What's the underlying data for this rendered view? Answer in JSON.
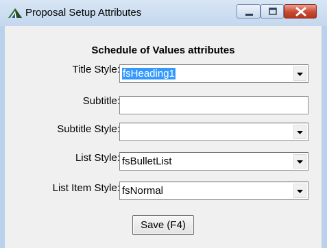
{
  "window": {
    "title": "Proposal Setup Attributes",
    "app_icon": "pyramid-icon",
    "controls": {
      "minimize_icon": "minimize-icon",
      "maximize_icon": "maximize-icon",
      "close_icon": "close-icon",
      "close_color": "#c74a33"
    }
  },
  "form": {
    "heading": "Schedule of Values attributes",
    "fields": [
      {
        "label": "Title Style:",
        "value": "fsHeading1",
        "type": "dropdown",
        "selected": true
      },
      {
        "label": "Subtitle:",
        "value": "",
        "type": "text"
      },
      {
        "label": "Subtitle Style:",
        "value": "",
        "type": "dropdown"
      },
      {
        "label": "List Style:",
        "value": "fsBulletList",
        "type": "dropdown"
      },
      {
        "label": "List Item Style:",
        "value": "fsNormal",
        "type": "dropdown"
      }
    ],
    "save_label": "Save (F4)"
  },
  "colors": {
    "selection": "#3399ff",
    "window_frame": "#b9d1ea",
    "client_bg": "#f0f0f0"
  }
}
